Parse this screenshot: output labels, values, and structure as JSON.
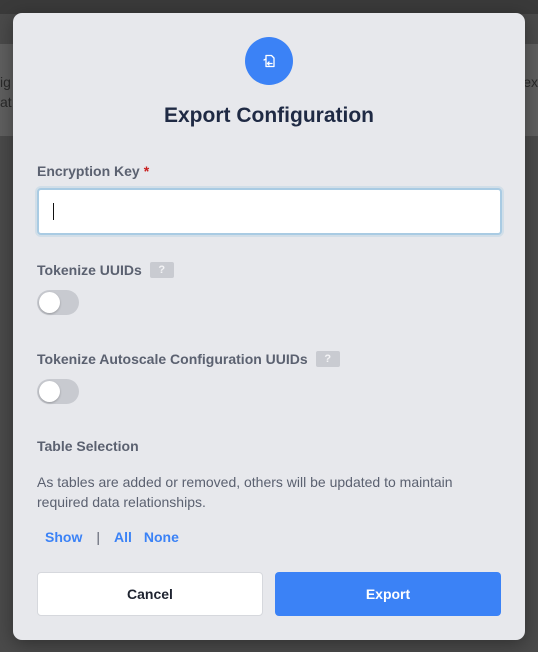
{
  "background": {
    "left_text_1": "ig",
    "left_text_2": "at",
    "right_text_1": "ex"
  },
  "modal": {
    "title": "Export Configuration",
    "icon": "export-config-icon",
    "encryption_key": {
      "label": "Encryption Key",
      "required_mark": "*",
      "value": "",
      "placeholder": ""
    },
    "tokenize_uuids": {
      "label": "Tokenize UUIDs",
      "help": "?",
      "enabled": false
    },
    "tokenize_autoscale": {
      "label": "Tokenize Autoscale Configuration UUIDs",
      "help": "?",
      "enabled": false
    },
    "table_selection": {
      "label": "Table Selection",
      "description": "As tables are added or removed, others will be updated to maintain required data relationships.",
      "show_label": "Show",
      "separator": "|",
      "all_label": "All",
      "none_label": "None"
    },
    "buttons": {
      "cancel": "Cancel",
      "export": "Export"
    }
  },
  "colors": {
    "accent": "#3b82f6",
    "modal_bg": "#e7e8ec",
    "title": "#1f2a44",
    "required": "#c81e1e"
  }
}
